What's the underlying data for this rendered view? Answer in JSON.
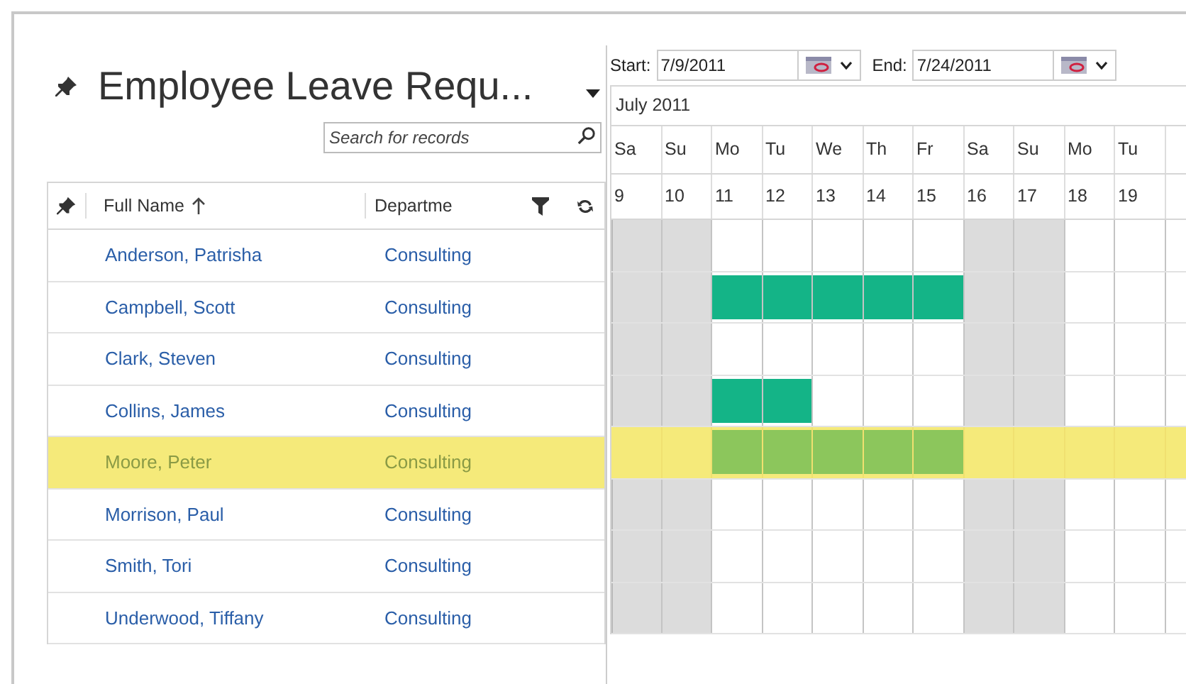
{
  "title": "Employee Leave Requ...",
  "search": {
    "placeholder": "Search for records"
  },
  "columns": [
    {
      "label": "Full Name",
      "sorted": true
    },
    {
      "label": "Departme",
      "sorted": false
    }
  ],
  "date_range": {
    "start_label": "Start:",
    "start": "7/9/2011",
    "end_label": "End:",
    "end": "7/24/2011"
  },
  "month": "July 2011",
  "days": [
    {
      "name": "Sa",
      "date": "9",
      "weekend": true
    },
    {
      "name": "Su",
      "date": "10",
      "weekend": true
    },
    {
      "name": "Mo",
      "date": "11",
      "weekend": false
    },
    {
      "name": "Tu",
      "date": "12",
      "weekend": false
    },
    {
      "name": "We",
      "date": "13",
      "weekend": false
    },
    {
      "name": "Th",
      "date": "14",
      "weekend": false
    },
    {
      "name": "Fr",
      "date": "15",
      "weekend": false
    },
    {
      "name": "Sa",
      "date": "16",
      "weekend": true
    },
    {
      "name": "Su",
      "date": "17",
      "weekend": true
    },
    {
      "name": "Mo",
      "date": "18",
      "weekend": false
    },
    {
      "name": "Tu",
      "date": "19",
      "weekend": false
    }
  ],
  "rows": [
    {
      "name": "Anderson, Patrisha",
      "department": "Consulting",
      "selected": false,
      "on_leave": [
        false,
        false,
        false,
        false,
        false,
        false,
        false,
        false,
        false,
        false,
        false
      ]
    },
    {
      "name": "Campbell, Scott",
      "department": "Consulting",
      "selected": false,
      "on_leave": [
        false,
        false,
        true,
        true,
        true,
        true,
        true,
        false,
        false,
        false,
        false
      ]
    },
    {
      "name": "Clark, Steven",
      "department": "Consulting",
      "selected": false,
      "on_leave": [
        false,
        false,
        false,
        false,
        false,
        false,
        false,
        false,
        false,
        false,
        false
      ]
    },
    {
      "name": "Collins, James",
      "department": "Consulting",
      "selected": false,
      "on_leave": [
        false,
        false,
        true,
        true,
        false,
        false,
        false,
        false,
        false,
        false,
        false
      ]
    },
    {
      "name": "Moore, Peter",
      "department": "Consulting",
      "selected": true,
      "on_leave": [
        false,
        false,
        true,
        true,
        true,
        true,
        true,
        false,
        false,
        false,
        false
      ]
    },
    {
      "name": "Morrison, Paul",
      "department": "Consulting",
      "selected": false,
      "on_leave": [
        false,
        false,
        false,
        false,
        false,
        false,
        false,
        false,
        false,
        false,
        false
      ]
    },
    {
      "name": "Smith, Tori",
      "department": "Consulting",
      "selected": false,
      "on_leave": [
        false,
        false,
        false,
        false,
        false,
        false,
        false,
        false,
        false,
        false,
        false
      ]
    },
    {
      "name": "Underwood, Tiffany",
      "department": "Consulting",
      "selected": false,
      "on_leave": [
        false,
        false,
        false,
        false,
        false,
        false,
        false,
        false,
        false,
        false,
        false
      ]
    }
  ]
}
